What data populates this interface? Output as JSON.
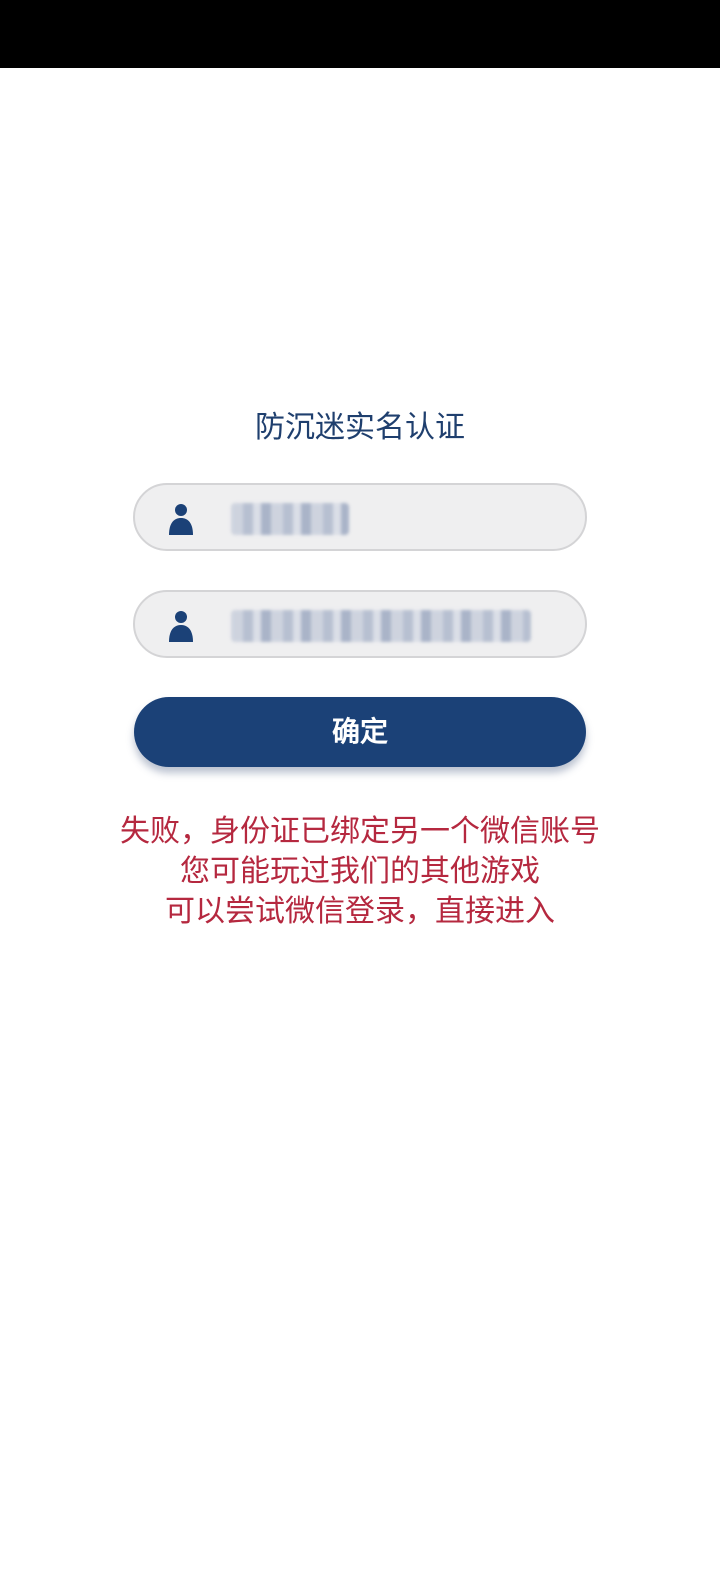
{
  "header": {
    "title": "防沉迷实名认证"
  },
  "form": {
    "name_field": {
      "icon": "user-icon",
      "value": "(blurred)"
    },
    "id_field": {
      "icon": "user-icon",
      "value": "(blurred)"
    },
    "confirm_label": "确定"
  },
  "message": {
    "lines": [
      "失败，身份证已绑定另一个微信账号",
      "您可能玩过我们的其他游戏",
      "可以尝试微信登录，直接进入"
    ],
    "color": "#b5283f"
  },
  "colors": {
    "accent": "#1b4177",
    "title": "#1f3f6e"
  }
}
